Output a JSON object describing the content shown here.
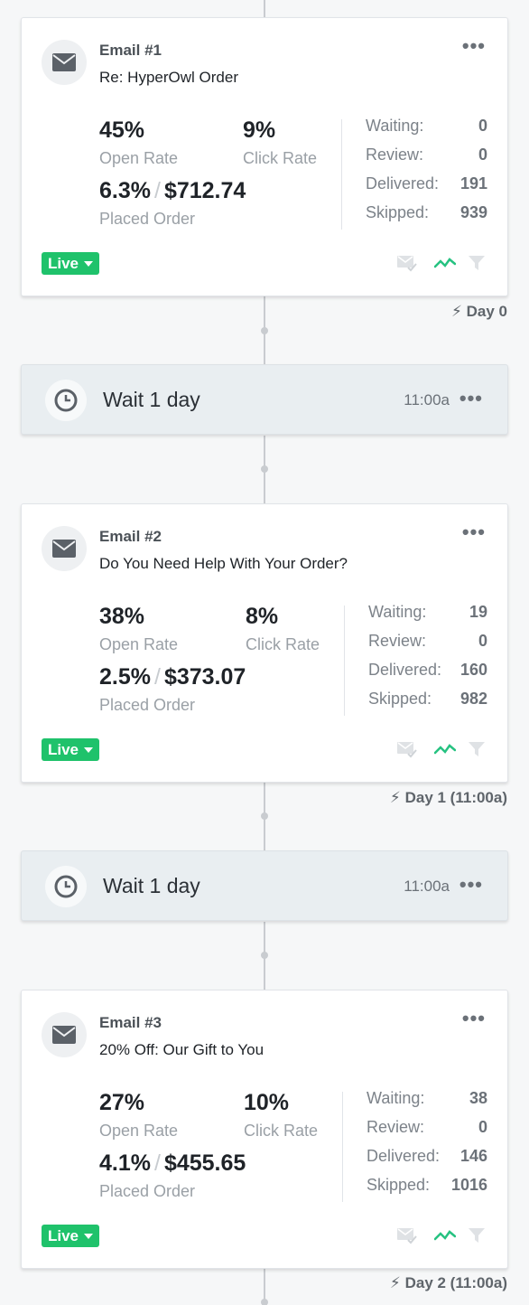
{
  "emails": [
    {
      "label": "Email #1",
      "subject": "Re: HyperOwl Order",
      "open_rate": "45%",
      "open_rate_label": "Open Rate",
      "click_rate": "9%",
      "click_rate_label": "Click Rate",
      "placed_pct": "6.3%",
      "placed_sep": "/",
      "placed_value": "$712.74",
      "placed_label": "Placed Order",
      "waiting_label": "Waiting:",
      "waiting": "0",
      "review_label": "Review:",
      "review": "0",
      "delivered_label": "Delivered:",
      "delivered": "191",
      "skipped_label": "Skipped:",
      "skipped": "939",
      "status": "Live",
      "day": "Day 0"
    },
    {
      "label": "Email #2",
      "subject": "Do You Need Help With Your Order?",
      "open_rate": "38%",
      "open_rate_label": "Open Rate",
      "click_rate": "8%",
      "click_rate_label": "Click Rate",
      "placed_pct": "2.5%",
      "placed_sep": "/",
      "placed_value": "$373.07",
      "placed_label": "Placed Order",
      "waiting_label": "Waiting:",
      "waiting": "19",
      "review_label": "Review:",
      "review": "0",
      "delivered_label": "Delivered:",
      "delivered": "160",
      "skipped_label": "Skipped:",
      "skipped": "982",
      "status": "Live",
      "day": "Day 1 (11:00a)"
    },
    {
      "label": "Email #3",
      "subject": "20% Off: Our Gift to You",
      "open_rate": "27%",
      "open_rate_label": "Open Rate",
      "click_rate": "10%",
      "click_rate_label": "Click Rate",
      "placed_pct": "4.1%",
      "placed_sep": "/",
      "placed_value": "$455.65",
      "placed_label": "Placed Order",
      "waiting_label": "Waiting:",
      "waiting": "38",
      "review_label": "Review:",
      "review": "0",
      "delivered_label": "Delivered:",
      "delivered": "146",
      "skipped_label": "Skipped:",
      "skipped": "1016",
      "status": "Live",
      "day": "Day 2 (11:00a)"
    }
  ],
  "waits": [
    {
      "text": "Wait 1 day",
      "time": "11:00a"
    },
    {
      "text": "Wait 1 day",
      "time": "11:00a"
    }
  ],
  "icons": {
    "email": "envelope-icon",
    "wait": "clock-icon",
    "more": "more-dots-icon",
    "preview": "email-preview-icon",
    "analytics": "trend-icon",
    "filter": "filter-icon",
    "trigger": "lightning-icon"
  },
  "colors": {
    "live_green": "#1fc26b",
    "trend_green": "#26c281",
    "wait_bg": "#e9eef1",
    "background": "#f6f7f8"
  }
}
